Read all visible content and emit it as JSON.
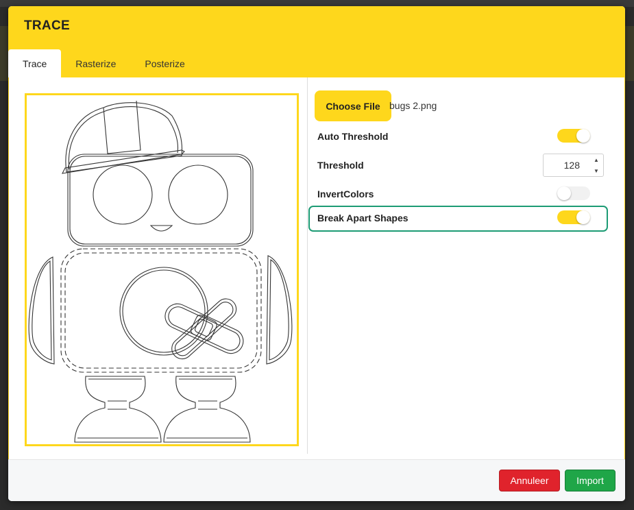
{
  "dialog": {
    "title": "TRACE",
    "tabs": [
      {
        "label": "Trace",
        "active": true
      },
      {
        "label": "Rasterize",
        "active": false
      },
      {
        "label": "Posterize",
        "active": false
      }
    ]
  },
  "file": {
    "button_label": "Choose File",
    "name": "bugs 2.png"
  },
  "options": {
    "auto_threshold": {
      "label": "Auto Threshold",
      "on": true
    },
    "threshold": {
      "label": "Threshold",
      "value": "128"
    },
    "invert_colors": {
      "label": "InvertColors",
      "on": false
    },
    "break_apart": {
      "label": "Break Apart Shapes",
      "on": true
    }
  },
  "footer": {
    "cancel_label": "Annuleer",
    "import_label": "Import"
  },
  "colors": {
    "accent": "#fed71c",
    "cancel": "#e0232c",
    "import": "#1fa648",
    "focus": "#1c9b74"
  },
  "icons": {
    "spin_up": "▲",
    "spin_down": "▼"
  }
}
